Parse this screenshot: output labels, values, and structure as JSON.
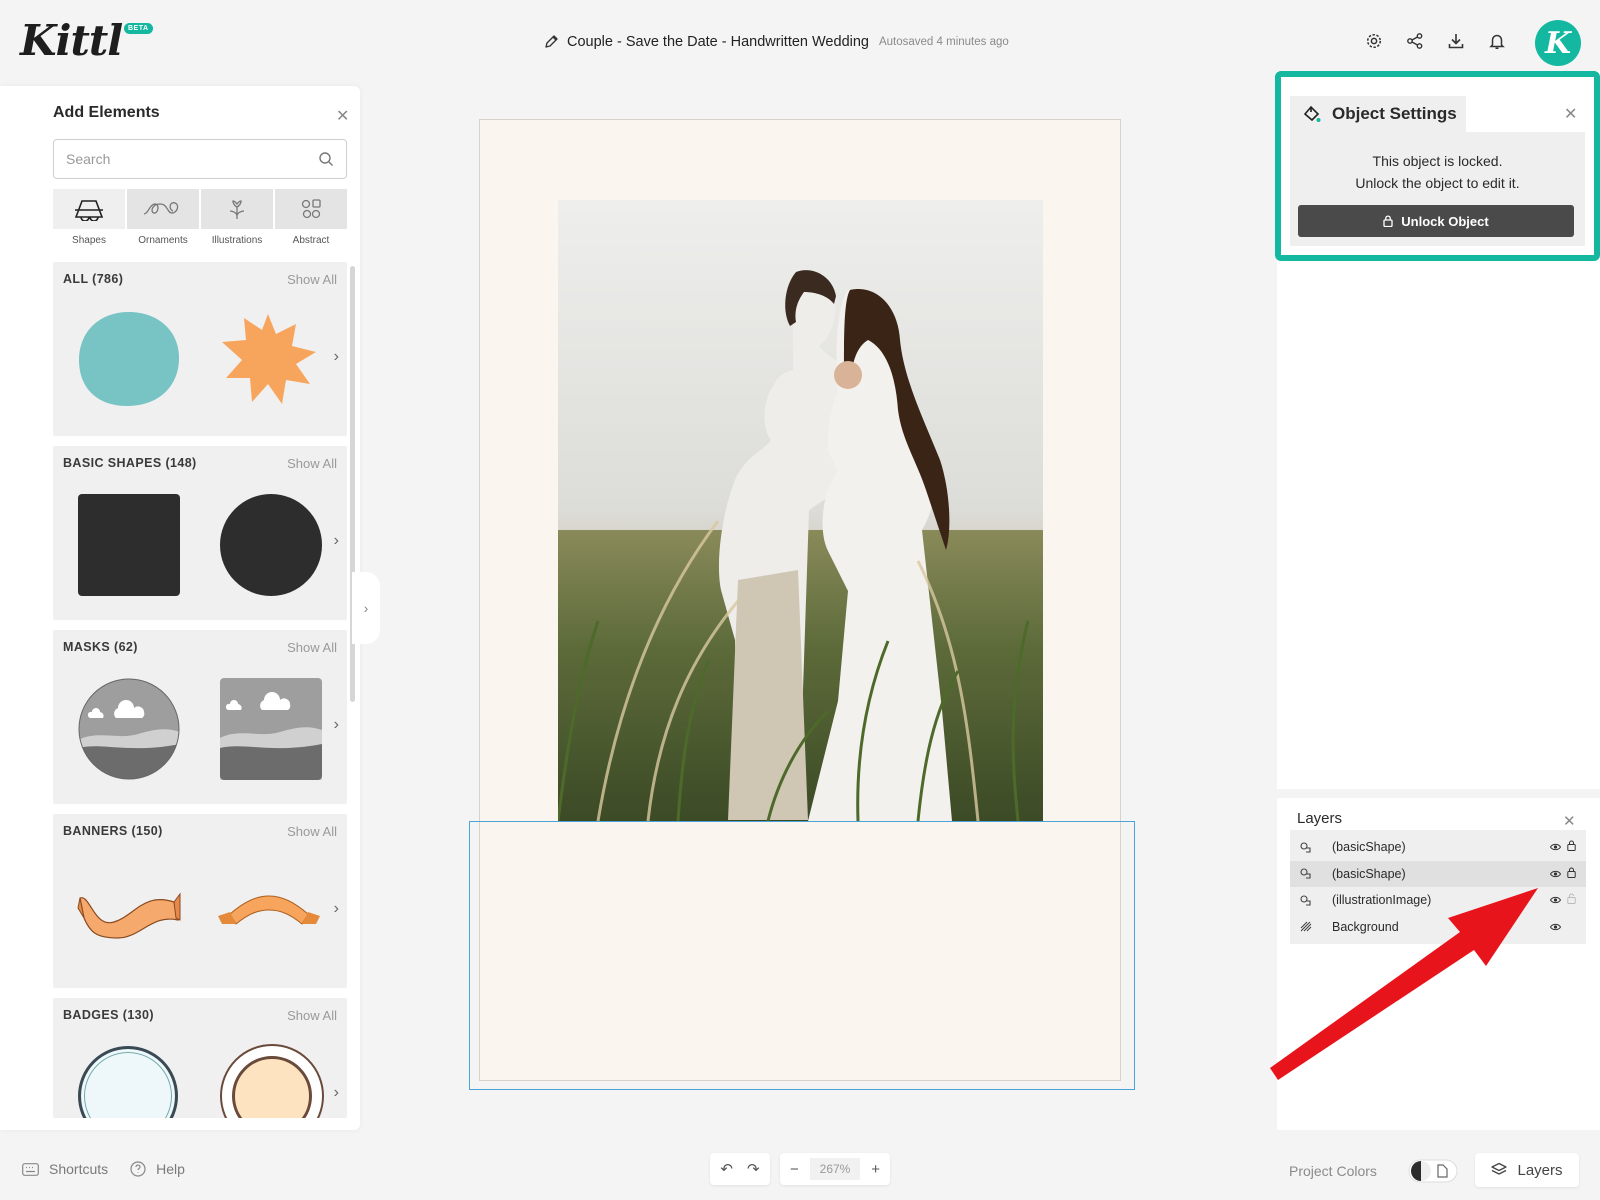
{
  "app": {
    "logo": "Kittl",
    "beta": "BETA",
    "avatar_letter": "K"
  },
  "document": {
    "title": "Couple - Save the Date - Handwritten Wedding",
    "autosave": "Autosaved 4 minutes ago"
  },
  "header_icons": [
    "gear-icon",
    "share-icon",
    "download-icon",
    "bell-icon"
  ],
  "rail_icons": [
    "edit-icon",
    "layout-icon",
    "text-icon",
    "elements-icon",
    "upload-icon",
    "camera-icon",
    "dots-grid-icon"
  ],
  "add_elements": {
    "title": "Add Elements",
    "search_placeholder": "Search",
    "tabs": [
      {
        "label": "Shapes",
        "icon": "shapes-icon",
        "active": true
      },
      {
        "label": "Ornaments",
        "icon": "ornaments-icon",
        "active": false
      },
      {
        "label": "Illustrations",
        "icon": "illustrations-icon",
        "active": false
      },
      {
        "label": "Abstract",
        "icon": "abstract-icon",
        "active": false
      }
    ],
    "show_all": "Show All",
    "sections": [
      {
        "title": "ALL (786)"
      },
      {
        "title": "BASIC SHAPES (148)"
      },
      {
        "title": "MASKS (62)"
      },
      {
        "title": "BANNERS (150)"
      },
      {
        "title": "BADGES (130)"
      }
    ]
  },
  "object_settings": {
    "title": "Object Settings",
    "message_line1": "This object is locked.",
    "message_line2": "Unlock the object to edit it.",
    "unlock_label": "Unlock Object"
  },
  "layers": {
    "title": "Layers",
    "items": [
      {
        "name": "(basicShape)",
        "icon": "shape-layer-icon",
        "locked": true,
        "selected": false
      },
      {
        "name": "(basicShape)",
        "icon": "shape-layer-icon",
        "locked": true,
        "selected": true
      },
      {
        "name": "(illustrationImage)",
        "icon": "shape-layer-icon",
        "locked": false,
        "selected": false
      },
      {
        "name": "Background",
        "icon": "background-layer-icon",
        "locked": false,
        "selected": false
      }
    ]
  },
  "bottom": {
    "shortcuts": "Shortcuts",
    "help": "Help",
    "zoom": "267%",
    "project_colors": "Project Colors",
    "layers_button": "Layers"
  },
  "colors": {
    "accent": "#14b8a0",
    "annotation": "#e8141c",
    "selection": "#4aa4d8"
  }
}
